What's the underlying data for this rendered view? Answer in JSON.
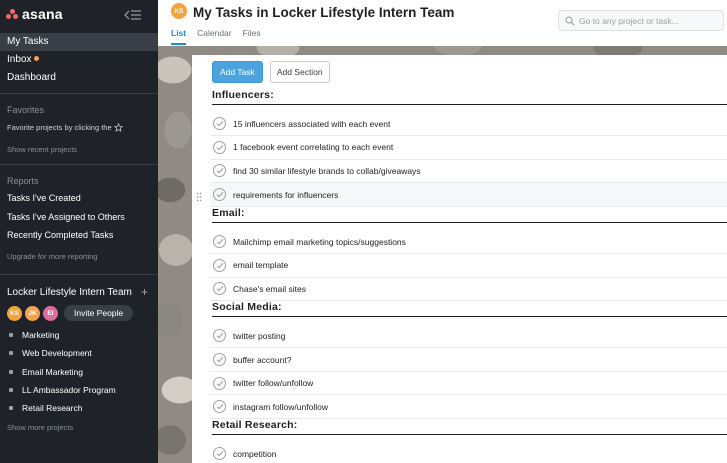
{
  "app": {
    "logo_text": "asana"
  },
  "sidebar": {
    "nav": [
      {
        "label": "My Tasks",
        "active": true
      },
      {
        "label": "Inbox",
        "has_dot": true
      },
      {
        "label": "Dashboard"
      }
    ],
    "favorites": {
      "header": "Favorites",
      "hint": "Favorite projects by clicking the",
      "show_recent": "Show recent projects"
    },
    "reports": {
      "header": "Reports",
      "items": [
        "Tasks I've Created",
        "Tasks I've Assigned to Others",
        "Recently Completed Tasks"
      ],
      "upgrade": "Upgrade for more reporting"
    },
    "team": {
      "name": "Locker Lifestyle Intern Team",
      "add_icon": "+",
      "avatars": [
        {
          "initials": "KS",
          "color": "#f2a33a"
        },
        {
          "initials": "JK",
          "color": "#f9a14d"
        },
        {
          "initials": "EI",
          "color": "#e06c9f"
        }
      ],
      "invite_label": "Invite People",
      "projects": [
        "Marketing",
        "Web Development",
        "Email Marketing",
        "LL Ambassador Program",
        "Retail Research"
      ],
      "show_more": "Show more projects"
    }
  },
  "header": {
    "avatar_initials": "KS",
    "title": "My Tasks in Locker Lifestyle Intern Team",
    "more_icon": "···",
    "search_placeholder": "Go to any project or task...",
    "tabs": [
      {
        "label": "List",
        "active": true
      },
      {
        "label": "Calendar"
      },
      {
        "label": "Files"
      }
    ]
  },
  "toolbar": {
    "add_task": "Add Task",
    "add_section": "Add Section"
  },
  "sections": [
    {
      "title": "Influencers:",
      "tasks": [
        "15 influencers associated with each event",
        "1 facebook event correlating to each event",
        "find 30 similar lifestyle brands to collab/giveaways",
        "requirements for influencers"
      ]
    },
    {
      "title": "Email:",
      "tasks": [
        "Mailchimp email marketing topics/suggestions",
        "email template",
        "Chase's email sites"
      ]
    },
    {
      "title": "Social Media:",
      "tasks": [
        "twitter posting",
        "buffer account?",
        "twitter follow/unfollow",
        "instagram follow/unfollow"
      ]
    },
    {
      "title": "Retail Research:",
      "tasks": [
        "competition"
      ]
    }
  ]
}
